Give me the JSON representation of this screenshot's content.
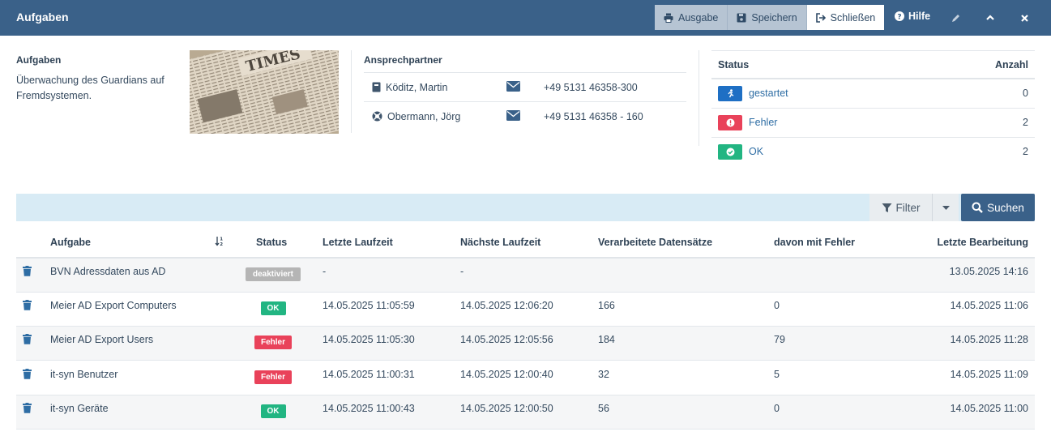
{
  "header": {
    "title": "Aufgaben",
    "buttons": {
      "output": "Ausgabe",
      "save": "Speichern",
      "close": "Schließen",
      "help": "Hilfe"
    }
  },
  "info": {
    "section_title": "Aufgaben",
    "description": "Überwachung des Guardians auf Fremdsystemen.",
    "photo_text": "TIMES"
  },
  "contacts": {
    "title": "Ansprechpartner",
    "items": [
      {
        "name": "Köditz, Martin",
        "phone": "+49 5131 46358-300",
        "icon": "address-book-icon"
      },
      {
        "name": "Obermann, Jörg",
        "phone": "+49 5131 46358 - 160",
        "icon": "lifebuoy-icon"
      }
    ]
  },
  "status_summary": {
    "col_status": "Status",
    "col_count": "Anzahl",
    "rows": [
      {
        "label": "gestartet",
        "count": "0",
        "color": "#1e6fc4",
        "icon": "running-icon"
      },
      {
        "label": "Fehler",
        "count": "2",
        "color": "#e9425a",
        "icon": "exclamation-icon"
      },
      {
        "label": "OK",
        "count": "2",
        "color": "#22b582",
        "icon": "check-icon"
      }
    ]
  },
  "toolbar": {
    "filter_label": "Filter",
    "search_label": "Suchen"
  },
  "table": {
    "columns": [
      "Aufgabe",
      "Status",
      "Letzte Laufzeit",
      "Nächste Laufzeit",
      "Verarbeitete Datensätze",
      "davon mit Fehler",
      "Letzte Bearbeitung"
    ],
    "rows": [
      {
        "task": "BVN Adressdaten aus AD",
        "status": "deaktiviert",
        "status_color": "#b5b5b5",
        "last_run": "-",
        "next_run": "-",
        "processed": "",
        "errors": "",
        "last_edit": "13.05.2025 14:16"
      },
      {
        "task": "Meier AD Export Computers",
        "status": "OK",
        "status_color": "#22b582",
        "last_run": "14.05.2025 11:05:59",
        "next_run": "14.05.2025 12:06:20",
        "processed": "166",
        "errors": "0",
        "last_edit": "14.05.2025 11:06"
      },
      {
        "task": "Meier AD Export Users",
        "status": "Fehler",
        "status_color": "#e9425a",
        "last_run": "14.05.2025 11:05:30",
        "next_run": "14.05.2025 12:05:56",
        "processed": "184",
        "errors": "79",
        "last_edit": "14.05.2025 11:28"
      },
      {
        "task": "it-syn Benutzer",
        "status": "Fehler",
        "status_color": "#e9425a",
        "last_run": "14.05.2025 11:00:31",
        "next_run": "14.05.2025 12:00:40",
        "processed": "32",
        "errors": "5",
        "last_edit": "14.05.2025 11:09"
      },
      {
        "task": "it-syn Geräte",
        "status": "OK",
        "status_color": "#22b582",
        "last_run": "14.05.2025 11:00:43",
        "next_run": "14.05.2025 12:00:50",
        "processed": "56",
        "errors": "0",
        "last_edit": "14.05.2025 11:00"
      }
    ]
  }
}
